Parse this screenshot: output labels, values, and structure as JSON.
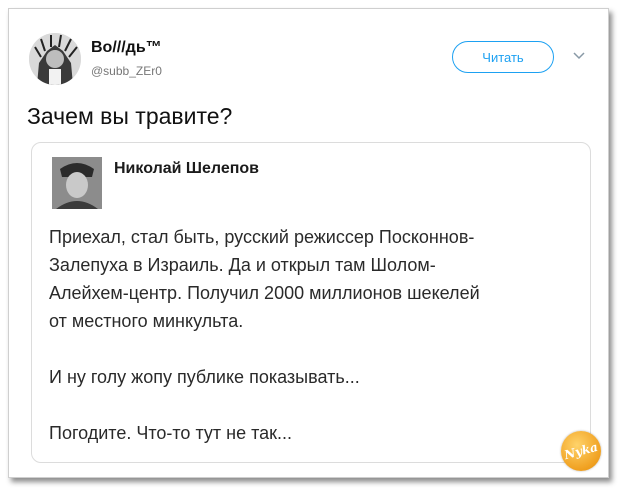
{
  "profile": {
    "display_name": "Во///дь™",
    "handle": "@subb_ZEr0",
    "follow_label": "Читать"
  },
  "tweet": {
    "text": "Зачем вы травите?"
  },
  "quoted_post": {
    "author": "Николай Шелепов",
    "lines": [
      "Приехал, стал быть, русский режиссер Посконнов-",
      "Залепуха в Израиль. Да и открыл там Шолом-",
      "Алейхем-центр. Получил 2000 миллионов шекелей",
      "от местного минкульта."
    ],
    "line2": "И ну голу жопу публике показывать...",
    "line3": "Погодите. Что-то тут не так..."
  },
  "watermark": {
    "text": "Nyka"
  },
  "colors": {
    "accent": "#1da1f2",
    "logo": "#f0a020"
  }
}
